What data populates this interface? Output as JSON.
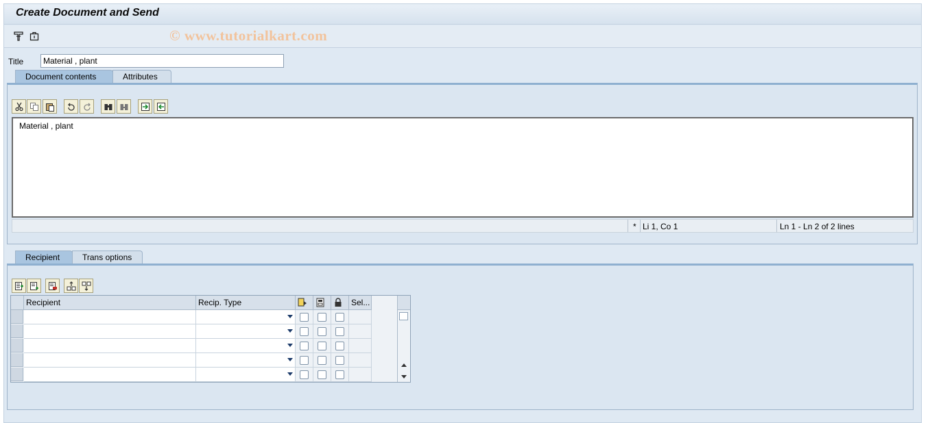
{
  "window": {
    "title": "Create Document and Send",
    "watermark": "© www.tutorialkart.com"
  },
  "toolbar": {
    "icons": [
      "display-change-icon",
      "attachment-icon"
    ]
  },
  "title_field": {
    "label": "Title",
    "value": "Material , plant"
  },
  "tabs_top": [
    {
      "label": "Document contents",
      "active": true
    },
    {
      "label": "Attributes",
      "active": false
    }
  ],
  "editor": {
    "toolbar_icons": [
      "cut-icon",
      "copy-icon",
      "paste-icon",
      "undo-icon",
      "redo-icon",
      "find-icon",
      "find-next-icon",
      "import-icon",
      "export-icon"
    ],
    "text": "Material , plant",
    "status": {
      "modified_marker": "*",
      "cursor": "Li 1, Co 1",
      "lines": "Ln 1 - Ln 2 of 2 lines"
    }
  },
  "tabs_bottom": [
    {
      "label": "Recipient",
      "active": true
    },
    {
      "label": "Trans options",
      "active": false
    }
  ],
  "recipient_table": {
    "toolbar_icons": [
      "insert-row-icon",
      "append-row-icon",
      "delete-row-icon",
      "sort-asc-icon",
      "sort-desc-icon"
    ],
    "columns": {
      "recipient": "Recipient",
      "recip_type": "Recip. Type",
      "express_icon": "express-icon",
      "copy_icon": "copy-icon",
      "blind_icon": "lock-icon",
      "sel": "Sel..."
    },
    "rows": [
      {
        "recipient": "",
        "recip_type": "",
        "express": false,
        "copy": false,
        "blind": false
      },
      {
        "recipient": "",
        "recip_type": "",
        "express": false,
        "copy": false,
        "blind": false
      },
      {
        "recipient": "",
        "recip_type": "",
        "express": false,
        "copy": false,
        "blind": false
      },
      {
        "recipient": "",
        "recip_type": "",
        "express": false,
        "copy": false,
        "blind": false
      },
      {
        "recipient": "",
        "recip_type": "",
        "express": false,
        "copy": false,
        "blind": false
      }
    ]
  },
  "colors": {
    "background": "#dfe9f3",
    "active_tab": "#a9c5e0",
    "watermark": "#f2c39c"
  }
}
